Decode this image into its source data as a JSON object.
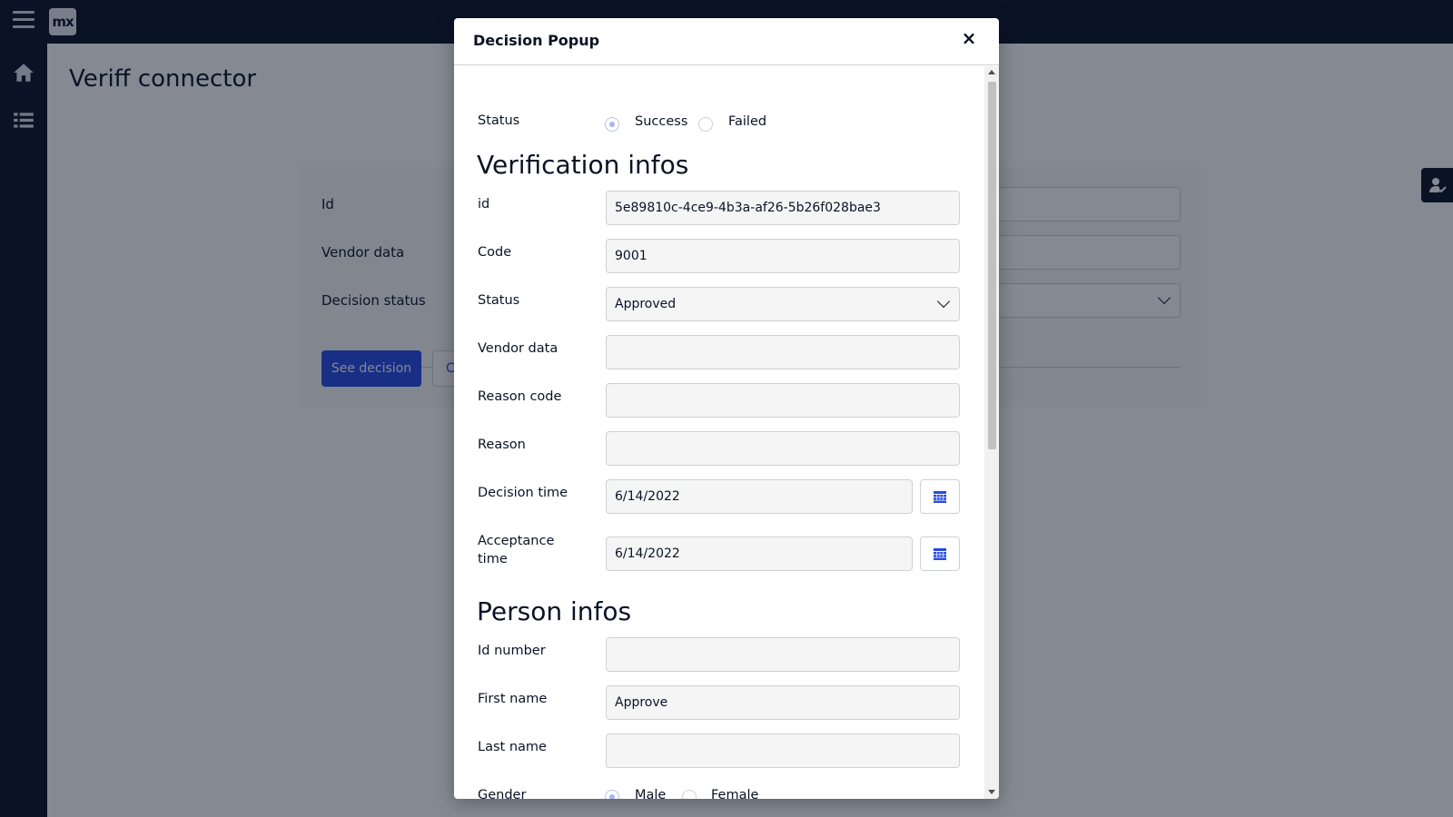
{
  "app": {
    "logo_text": "mx",
    "page_title": "Veriff connector"
  },
  "background_form": {
    "labels": [
      "Id",
      "Vendor data",
      "Decision status"
    ],
    "see_decision_label": "See decision",
    "secondary_button_label": "C"
  },
  "modal": {
    "title": "Decision Popup",
    "close_glyph": "×",
    "status": {
      "label": "Status",
      "options": [
        "Success",
        "Failed"
      ],
      "selected": "Success"
    },
    "verification": {
      "heading": "Verification infos",
      "id_label": "id",
      "id_value": "5e89810c-4ce9-4b3a-af26-5b26f028bae3",
      "code_label": "Code",
      "code_value": "9001",
      "status_label": "Status",
      "status_value": "Approved",
      "vendor_data_label": "Vendor data",
      "vendor_data_value": "",
      "reason_code_label": "Reason code",
      "reason_code_value": "",
      "reason_label": "Reason",
      "reason_value": "",
      "decision_time_label": "Decision time",
      "decision_time_value": "6/14/2022",
      "acceptance_time_label_line1": "Acceptance",
      "acceptance_time_label_line2": "time",
      "acceptance_time_value": "6/14/2022"
    },
    "person": {
      "heading": "Person infos",
      "id_number_label": "Id number",
      "id_number_value": "",
      "first_name_label": "First name",
      "first_name_value": "Approve",
      "last_name_label": "Last name",
      "last_name_value": "",
      "gender_label": "Gender",
      "gender_options": [
        "Male",
        "Female"
      ],
      "gender_selected": "Male"
    }
  },
  "colors": {
    "topbar": "#0a1326",
    "primary": "#264ae5",
    "overlay": "rgba(10,19,37,0.5)"
  },
  "icons": {
    "menu": "hamburger-icon",
    "home": "home-icon",
    "list": "list-icon",
    "calendar": "calendar-icon",
    "user_check": "user-check-icon"
  }
}
